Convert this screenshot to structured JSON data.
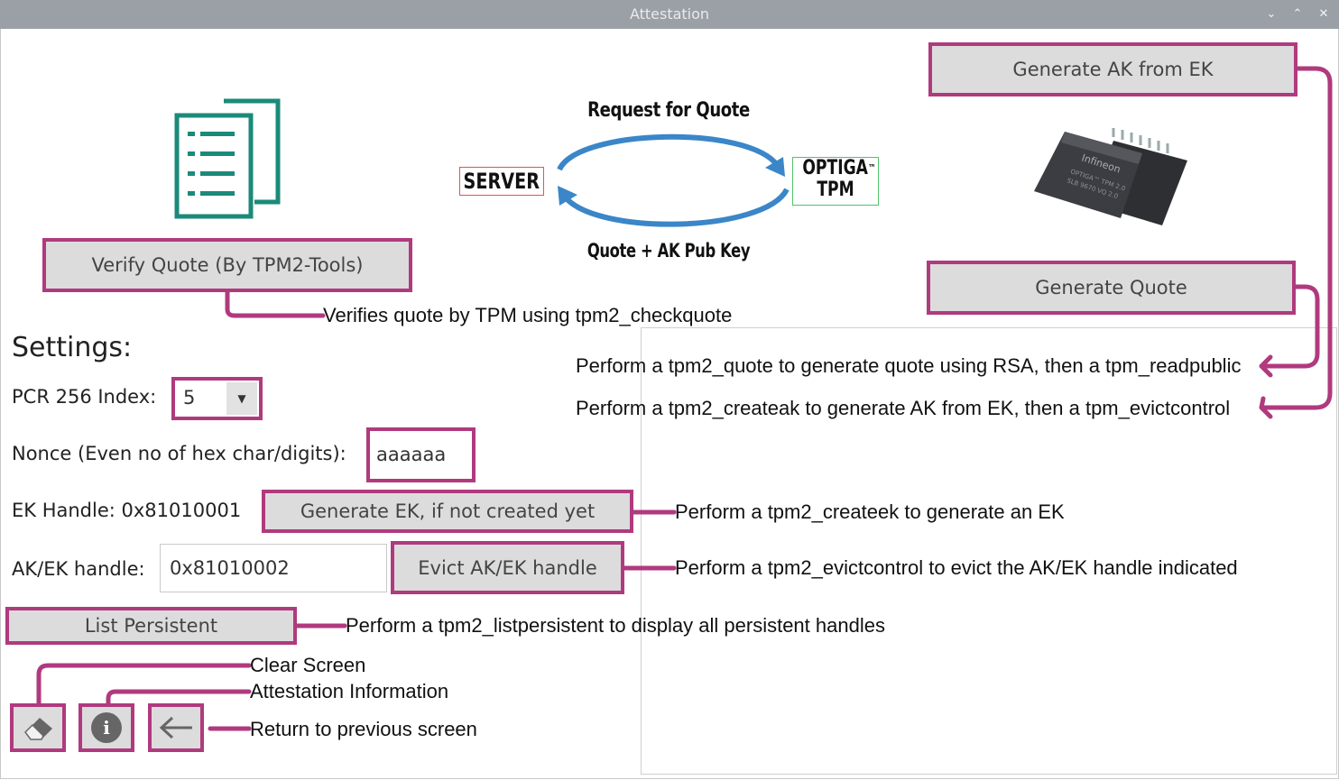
{
  "window": {
    "title": "Attestation",
    "controls": {
      "minimize": "⌄",
      "maximize": "⌃",
      "close": "✕"
    }
  },
  "colors": {
    "accent": "#b03a7e",
    "button_bg": "#dcdcdc",
    "titlebar": "#9aa0a6",
    "doc_icon": "#1b8a7a",
    "arrow": "#3a86c8"
  },
  "diagram": {
    "top_label": "Request for Quote",
    "bottom_label": "Quote + AK Pub Key",
    "server_label": "SERVER",
    "tpm_label_line1": "OPTIGA",
    "tpm_label_tm": "™",
    "tpm_label_line2": "TPM"
  },
  "chip": {
    "brand": "Infineon",
    "line1": "OPTIGA™ TPM 2.0",
    "line2": "SLB 9670 VQ 2.0"
  },
  "buttons": {
    "generate_ak": "Generate AK from EK",
    "verify_quote": "Verify Quote (By TPM2-Tools)",
    "generate_quote": "Generate Quote",
    "generate_ek": "Generate EK, if not created yet",
    "evict": "Evict AK/EK handle",
    "list_persistent": "List Persistent"
  },
  "settings": {
    "heading": "Settings:",
    "pcr_label": "PCR 256 Index:",
    "pcr_value": "5",
    "nonce_label": "Nonce (Even no of hex char/digits):",
    "nonce_value": "aaaaaa",
    "ek_handle_label": "EK Handle: 0x81010001",
    "ak_handle_label": "AK/EK handle:",
    "ak_handle_value": "0x81010002"
  },
  "bottom_icons": [
    "eraser-icon",
    "info-icon",
    "back-arrow-icon"
  ],
  "annotations": {
    "verify": "Verifies quote by TPM using tpm2_checkquote",
    "quote": "Perform a tpm2_quote to generate quote using RSA, then a tpm_readpublic",
    "createak": "Perform a tpm2_createak to generate AK from EK, then a tpm_evictcontrol",
    "createek": "Perform a tpm2_createek to generate an EK",
    "evict": "Perform a tpm2_evictcontrol to evict the AK/EK handle indicated",
    "list": "Perform a tpm2_listpersistent to display all persistent handles",
    "clear": "Clear Screen",
    "info": "Attestation Information",
    "back": "Return to previous screen"
  }
}
